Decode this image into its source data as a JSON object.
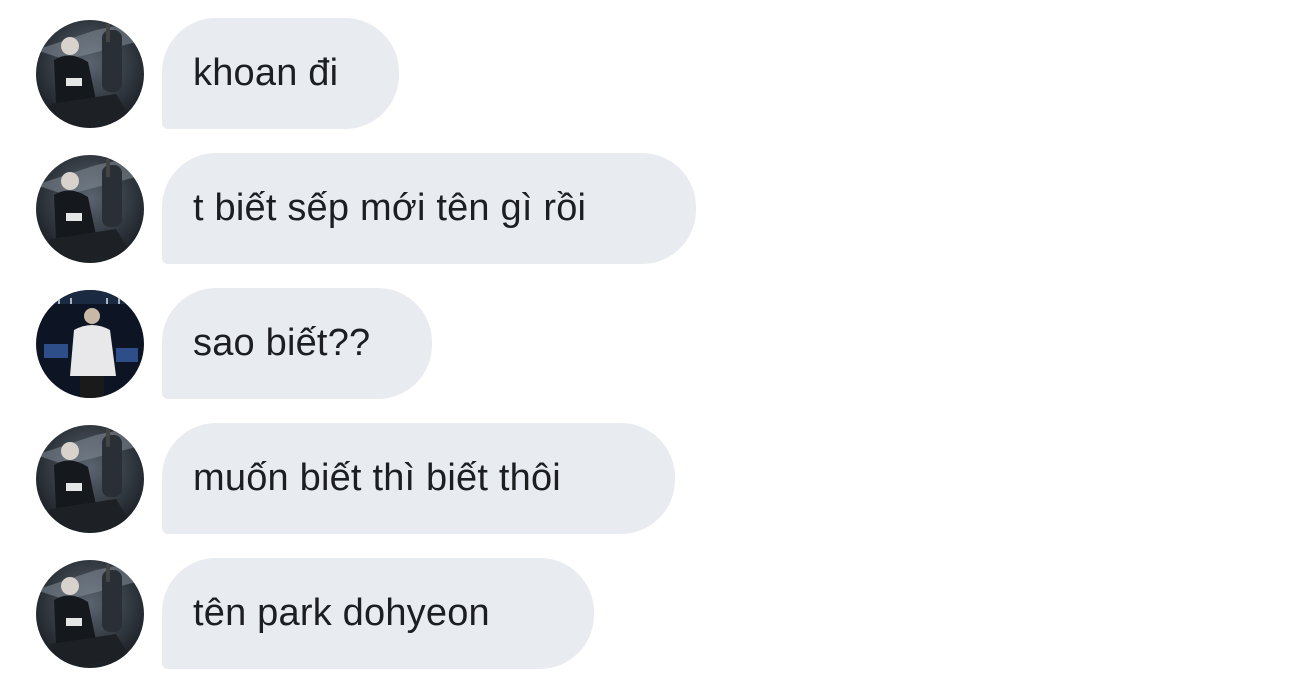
{
  "messages": [
    {
      "text": "khoan đi",
      "avatar": "avatar-dark-seated"
    },
    {
      "text": "t biết sếp mới tên gì rồi",
      "avatar": "avatar-dark-seated"
    },
    {
      "text": "sao biết??",
      "avatar": "avatar-stage-white-jacket"
    },
    {
      "text": "muốn biết thì biết thôi",
      "avatar": "avatar-dark-seated"
    },
    {
      "text": "tên park dohyeon",
      "avatar": "avatar-dark-seated"
    }
  ],
  "colors": {
    "bubble": "#e8ecf0",
    "text": "#1c1e21",
    "background": "#ffffff"
  }
}
